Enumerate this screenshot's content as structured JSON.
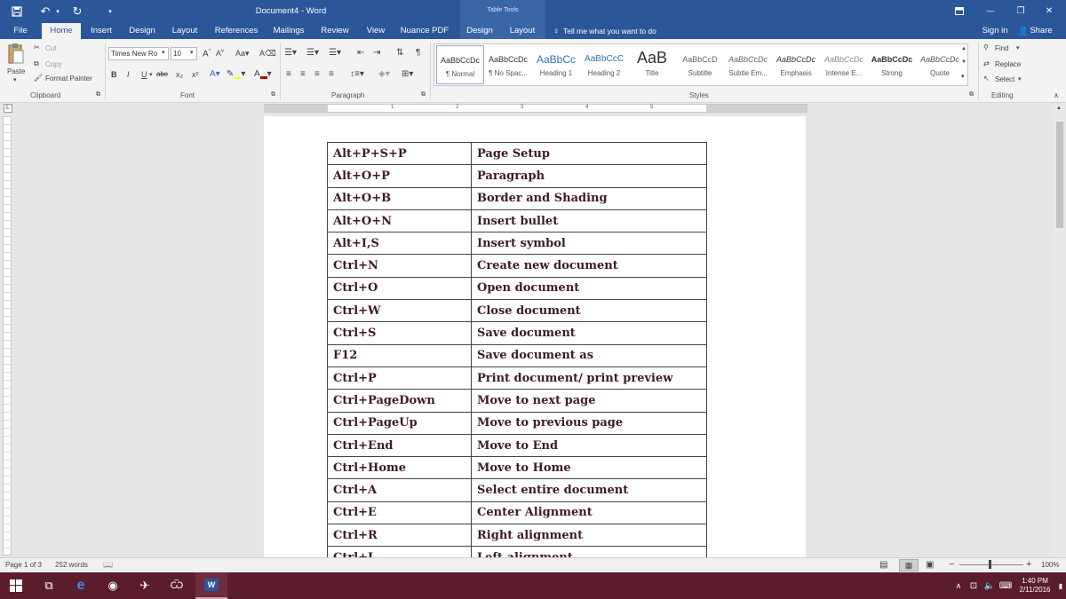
{
  "titlebar": {
    "title": "Document4 - Word",
    "save_icon": "save-icon",
    "undo_icon": "undo-icon",
    "redo_icon": "redo-icon",
    "context_group": "Table Tools",
    "ribbon_display_icon": "ribbon-display-icon",
    "minimize_glyph": "—",
    "restore_glyph": "❐",
    "close_glyph": "✕"
  },
  "tabs": {
    "file": "File",
    "home": "Home",
    "insert": "Insert",
    "design": "Design",
    "layout": "Layout",
    "references": "References",
    "mailings": "Mailings",
    "review": "Review",
    "view": "View",
    "nuance": "Nuance PDF",
    "table_design": "Design",
    "table_layout": "Layout",
    "tell_me": "Tell me what you want to do",
    "sign_in": "Sign in",
    "share": "Share"
  },
  "ribbon": {
    "clipboard": {
      "paste": "Paste",
      "cut": "Cut",
      "copy": "Copy",
      "format_painter": "Format Painter",
      "label": "Clipboard"
    },
    "font": {
      "name": "Times New Ro",
      "size": "10",
      "label": "Font",
      "bold": "B",
      "italic": "I",
      "underline": "U",
      "strike": "abc",
      "subscript": "x₂",
      "superscript": "x²"
    },
    "paragraph": {
      "label": "Paragraph"
    },
    "styles": {
      "label": "Styles",
      "items": [
        {
          "preview": "AaBbCcDc",
          "name": "¶ Normal"
        },
        {
          "preview": "AaBbCcDc",
          "name": "¶ No Spac..."
        },
        {
          "preview": "AaBbCc",
          "name": "Heading 1"
        },
        {
          "preview": "AaBbCcC",
          "name": "Heading 2"
        },
        {
          "preview": "AaB",
          "name": "Title"
        },
        {
          "preview": "AaBbCcD",
          "name": "Subtitle"
        },
        {
          "preview": "AaBbCcDc",
          "name": "Subtle Em..."
        },
        {
          "preview": "AaBbCcDc",
          "name": "Emphasis"
        },
        {
          "preview": "AaBbCcDc",
          "name": "Intense E..."
        },
        {
          "preview": "AaBbCcDc",
          "name": "Strong"
        },
        {
          "preview": "AaBbCcDc",
          "name": "Quote"
        }
      ]
    },
    "editing": {
      "find": "Find",
      "replace": "Replace",
      "select": "Select",
      "label": "Editing"
    }
  },
  "ruler": {
    "marks": [
      "1",
      "2",
      "3",
      "4",
      "5"
    ]
  },
  "document": {
    "rows": [
      {
        "key": "Alt+P+S+P",
        "desc": "Page Setup"
      },
      {
        "key": "Alt+O+P",
        "desc": "Paragraph"
      },
      {
        "key": "Alt+O+B",
        "desc": "Border and Shading"
      },
      {
        "key": "Alt+O+N",
        "desc": "Insert bullet"
      },
      {
        "key": "Alt+I,S",
        "desc": "Insert symbol"
      },
      {
        "key": "Ctrl+N",
        "desc": "Create new document"
      },
      {
        "key": "Ctrl+O",
        "desc": "Open document"
      },
      {
        "key": "Ctrl+W",
        "desc": "Close document"
      },
      {
        "key": "Ctrl+S",
        "desc": "Save document"
      },
      {
        "key": "F12",
        "desc": "Save document as"
      },
      {
        "key": "Ctrl+P",
        "desc": "Print document/ print preview"
      },
      {
        "key": "Ctrl+PageDown",
        "desc": "Move to next page"
      },
      {
        "key": "Ctrl+PageUp",
        "desc": "Move to previous page"
      },
      {
        "key": "Ctrl+End",
        "desc": "Move to End"
      },
      {
        "key": "Ctrl+Home",
        "desc": "Move to Home"
      },
      {
        "key": "Ctrl+A",
        "desc": "Select entire document"
      },
      {
        "key": "Ctrl+E",
        "desc": "Center Alignment"
      },
      {
        "key": "Ctrl+R",
        "desc": "Right alignment"
      },
      {
        "key": "Ctrl+L",
        "desc": "Left alignment"
      }
    ]
  },
  "status": {
    "page": "Page 1 of 3",
    "words": "252 words",
    "zoom": "100%",
    "zoom_out": "−",
    "zoom_in": "+"
  },
  "taskbar": {
    "time": "1:40 PM",
    "date": "2/11/2016",
    "icons": [
      "windows-start-icon",
      "task-view-icon",
      "edge-icon",
      "chrome-icon",
      "app-icon",
      "app-icon-2",
      "word-icon"
    ]
  },
  "colors": {
    "word_blue": "#2b579a",
    "taskbar": "#5b1c2c",
    "doc_text": "#3d1a2a"
  }
}
